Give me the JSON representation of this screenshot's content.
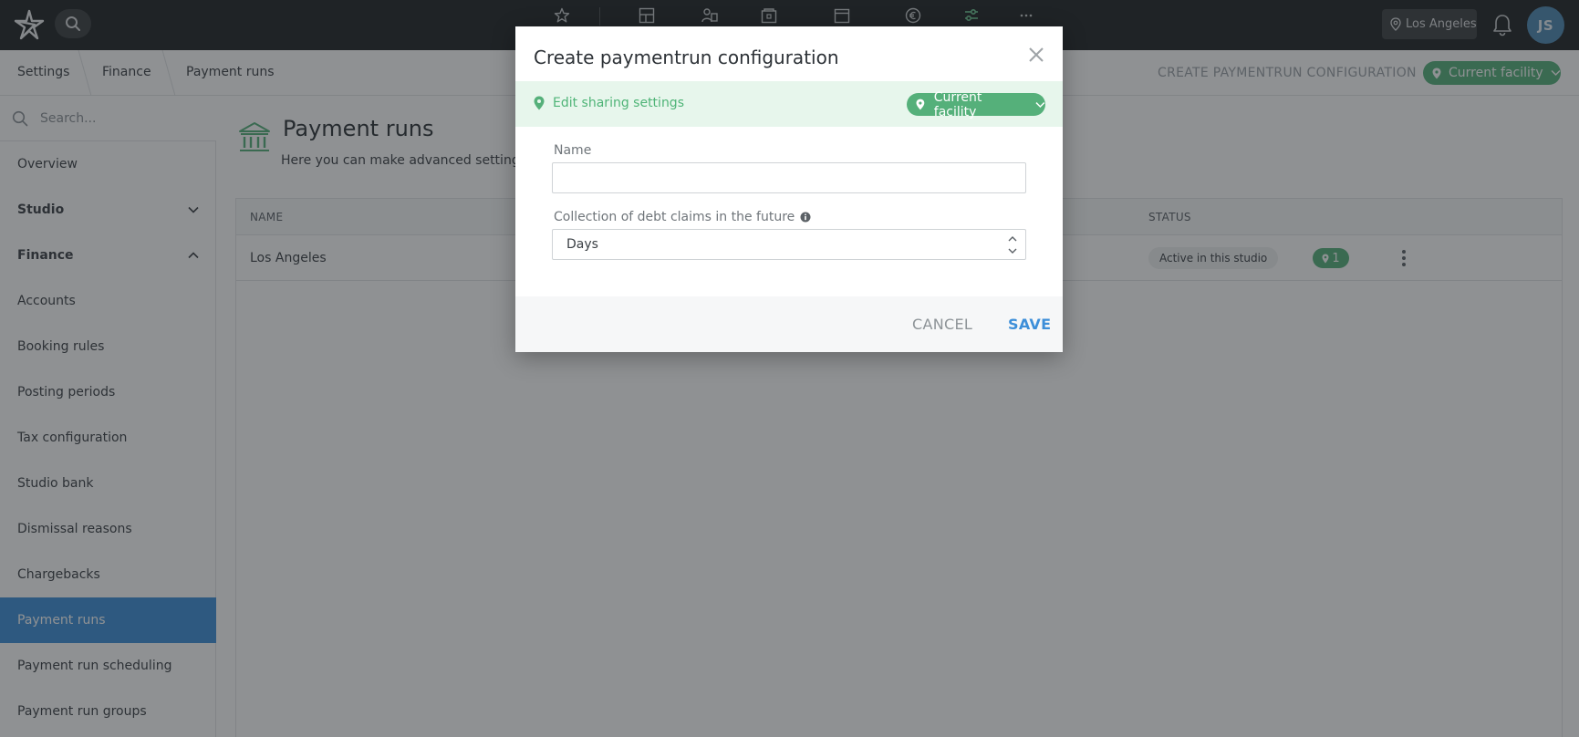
{
  "topbar": {
    "location_label": "Los Angeles",
    "avatar_initials": "JS",
    "icons": [
      "logo-icon",
      "search-icon",
      "star-icon",
      "layout-icon",
      "people-icon",
      "lock-box-icon",
      "calendar-icon",
      "euro-icon",
      "sliders-icon",
      "more-icon",
      "location-pin-icon",
      "bell-icon"
    ]
  },
  "breadcrumb": {
    "items": [
      "Settings",
      "Finance",
      "Payment runs"
    ],
    "action_label": "CREATE PAYMENTRUN CONFIGURATION",
    "facility_label": "Current facility"
  },
  "sidebar": {
    "search_placeholder": "Search...",
    "items": [
      {
        "label": "Overview"
      },
      {
        "label": "Studio"
      },
      {
        "label": "Finance"
      },
      {
        "label": "Accounts"
      },
      {
        "label": "Booking rules"
      },
      {
        "label": "Posting periods"
      },
      {
        "label": "Tax configuration"
      },
      {
        "label": "Studio bank"
      },
      {
        "label": "Dismissal reasons"
      },
      {
        "label": "Chargebacks"
      },
      {
        "label": "Payment runs"
      },
      {
        "label": "Payment run scheduling"
      },
      {
        "label": "Payment run groups"
      }
    ],
    "active_item": "Payment runs"
  },
  "main": {
    "title": "Payment runs",
    "description": "Here you can make advanced settings fo",
    "table": {
      "columns": [
        "NAME",
        "STATUS"
      ],
      "rows": [
        {
          "name": "Los Angeles",
          "status": "Active in this studio",
          "count": "1"
        }
      ]
    }
  },
  "modal": {
    "title": "Create paymentrun configuration",
    "share_link": "Edit sharing settings",
    "facility_label": "Current facility",
    "name_label": "Name",
    "name_value": "",
    "debt_label": "Collection of debt claims in the future",
    "debt_unit": "Days",
    "cancel_label": "CANCEL",
    "save_label": "SAVE"
  },
  "colors": {
    "topbar": "#1f2224",
    "accent_blue": "#3d8fd9",
    "accent_green": "#55b07a",
    "share_band": "#e7f6ec"
  }
}
